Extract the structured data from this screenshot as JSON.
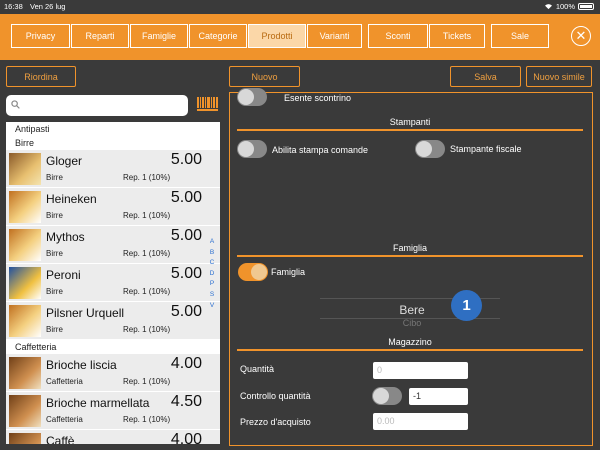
{
  "status": {
    "time": "16:38",
    "date": "Ven 26 lug",
    "battery": "100%"
  },
  "tabs": [
    {
      "label": "Privacy",
      "active": false
    },
    {
      "label": "Reparti",
      "active": false
    },
    {
      "label": "Famiglie",
      "active": false
    },
    {
      "label": "Categorie",
      "active": false
    },
    {
      "label": "Prodotti",
      "active": true
    },
    {
      "label": "Varianti",
      "active": false
    },
    {
      "label": "Sconti",
      "active": false
    },
    {
      "label": "Tickets",
      "active": false
    },
    {
      "label": "Sale",
      "active": false
    }
  ],
  "actions": {
    "riordina": "Riordina",
    "nuovo": "Nuovo",
    "salva": "Salva",
    "nuovo_simile": "Nuovo simile"
  },
  "search": {
    "placeholder": ""
  },
  "list": {
    "groups": [
      {
        "name": "Antipasti"
      },
      {
        "name": "Birre"
      },
      {
        "name": "Caffetteria"
      }
    ],
    "items": [
      {
        "name": "Gloger",
        "price": "5.00",
        "category": "Birre",
        "rep": "Rep. 1 (10%)"
      },
      {
        "name": "Heineken",
        "price": "5.00",
        "category": "Birre",
        "rep": "Rep. 1 (10%)"
      },
      {
        "name": "Mythos",
        "price": "5.00",
        "category": "Birre",
        "rep": "Rep. 1 (10%)"
      },
      {
        "name": "Peroni",
        "price": "5.00",
        "category": "Birre",
        "rep": "Rep. 1 (10%)"
      },
      {
        "name": "Pilsner Urquell",
        "price": "5.00",
        "category": "Birre",
        "rep": "Rep. 1 (10%)"
      },
      {
        "name": "Brioche liscia",
        "price": "4.00",
        "category": "Caffetteria",
        "rep": "Rep. 1 (10%)"
      },
      {
        "name": "Brioche marmellata",
        "price": "4.50",
        "category": "Caffetteria",
        "rep": "Rep. 1 (10%)"
      },
      {
        "name": "Caffè",
        "price": "4.00",
        "category": "",
        "rep": ""
      }
    ],
    "index_letters": [
      "A",
      "B",
      "C",
      "D",
      "P",
      "S",
      "V"
    ]
  },
  "detail": {
    "esente_label": "Esente scontrino",
    "stampanti_title": "Stampanti",
    "abilita_label": "Abilita stampa comande",
    "stampante_label": "Stampante fiscale",
    "famiglia_title": "Famiglia",
    "famiglia_label": "Famiglia",
    "famiglia_enabled": true,
    "picker_selected": "Bere",
    "picker_next": "Cibo",
    "badge": "1",
    "magazzino_title": "Magazzino",
    "quantita_label": "Quantità",
    "quantita_placeholder": "0",
    "controllo_label": "Controllo quantità",
    "controllo_value": "-1",
    "prezzo_label": "Prezzo d'acquisto",
    "prezzo_placeholder": "0.00"
  },
  "colors": {
    "accent": "#f0932b",
    "background": "#3a3a3a",
    "badge": "#2f6fc2"
  }
}
